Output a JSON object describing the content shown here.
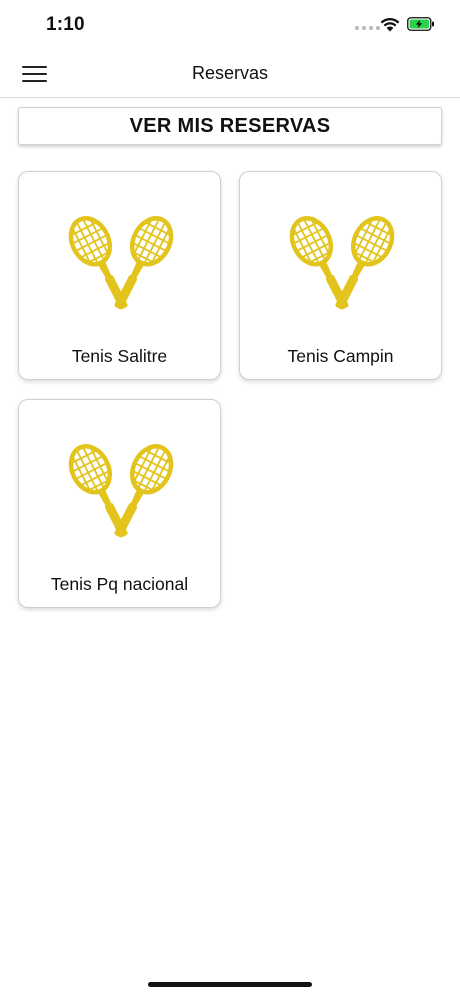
{
  "status_bar": {
    "time": "1:10",
    "icons": [
      "signal-dots-icon",
      "wifi-icon",
      "battery-charging-icon"
    ],
    "battery_color": "#2bd14a"
  },
  "nav": {
    "title": "Reservas",
    "menu_icon": "hamburger-menu-icon"
  },
  "main": {
    "reservas_button_label": "VER MIS RESERVAS",
    "cards": [
      {
        "label": "Tenis Salitre",
        "icon": "tennis-rackets-icon"
      },
      {
        "label": "Tenis Campin",
        "icon": "tennis-rackets-icon"
      },
      {
        "label": "Tenis Pq nacional",
        "icon": "tennis-rackets-icon"
      }
    ]
  },
  "colors": {
    "accent": "#e2c41c",
    "card_border": "#cfcfcf"
  }
}
